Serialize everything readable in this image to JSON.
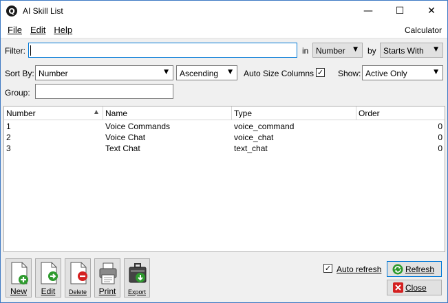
{
  "window": {
    "title": "AI Skill List",
    "icon_letter": "Q",
    "minimize": "—",
    "maximize": "☐",
    "close": "✕"
  },
  "menu": {
    "file": "File",
    "edit": "Edit",
    "help": "Help",
    "calculator": "Calculator"
  },
  "filter": {
    "label": "Filter:",
    "value": "",
    "in_label": "in",
    "in_value": "Number",
    "by_label": "by",
    "by_value": "Starts With"
  },
  "sort": {
    "label": "Sort By:",
    "field": "Number",
    "direction": "Ascending",
    "autosize_label": "Auto Size Columns",
    "autosize_checked": true,
    "show_label": "Show:",
    "show_value": "Active Only"
  },
  "group": {
    "label": "Group:",
    "value": ""
  },
  "table": {
    "columns": [
      "Number",
      "Name",
      "Type",
      "Order"
    ],
    "rows": [
      {
        "number": "1",
        "name": "Voice Commands",
        "type": "voice_command",
        "order": "0"
      },
      {
        "number": "2",
        "name": "Voice Chat",
        "type": "voice_chat",
        "order": "0"
      },
      {
        "number": "3",
        "name": "Text Chat",
        "type": "text_chat",
        "order": "0"
      }
    ]
  },
  "toolbar": {
    "new": "New",
    "edit": "Edit",
    "delete": "Delete",
    "print": "Print",
    "export": "Export"
  },
  "footer": {
    "auto_refresh_label": "Auto refresh",
    "auto_refresh_checked": true,
    "refresh": "Refresh",
    "close": "Close"
  },
  "colors": {
    "accent": "#0078d7",
    "green": "#2e9a2e",
    "red": "#d42020"
  }
}
